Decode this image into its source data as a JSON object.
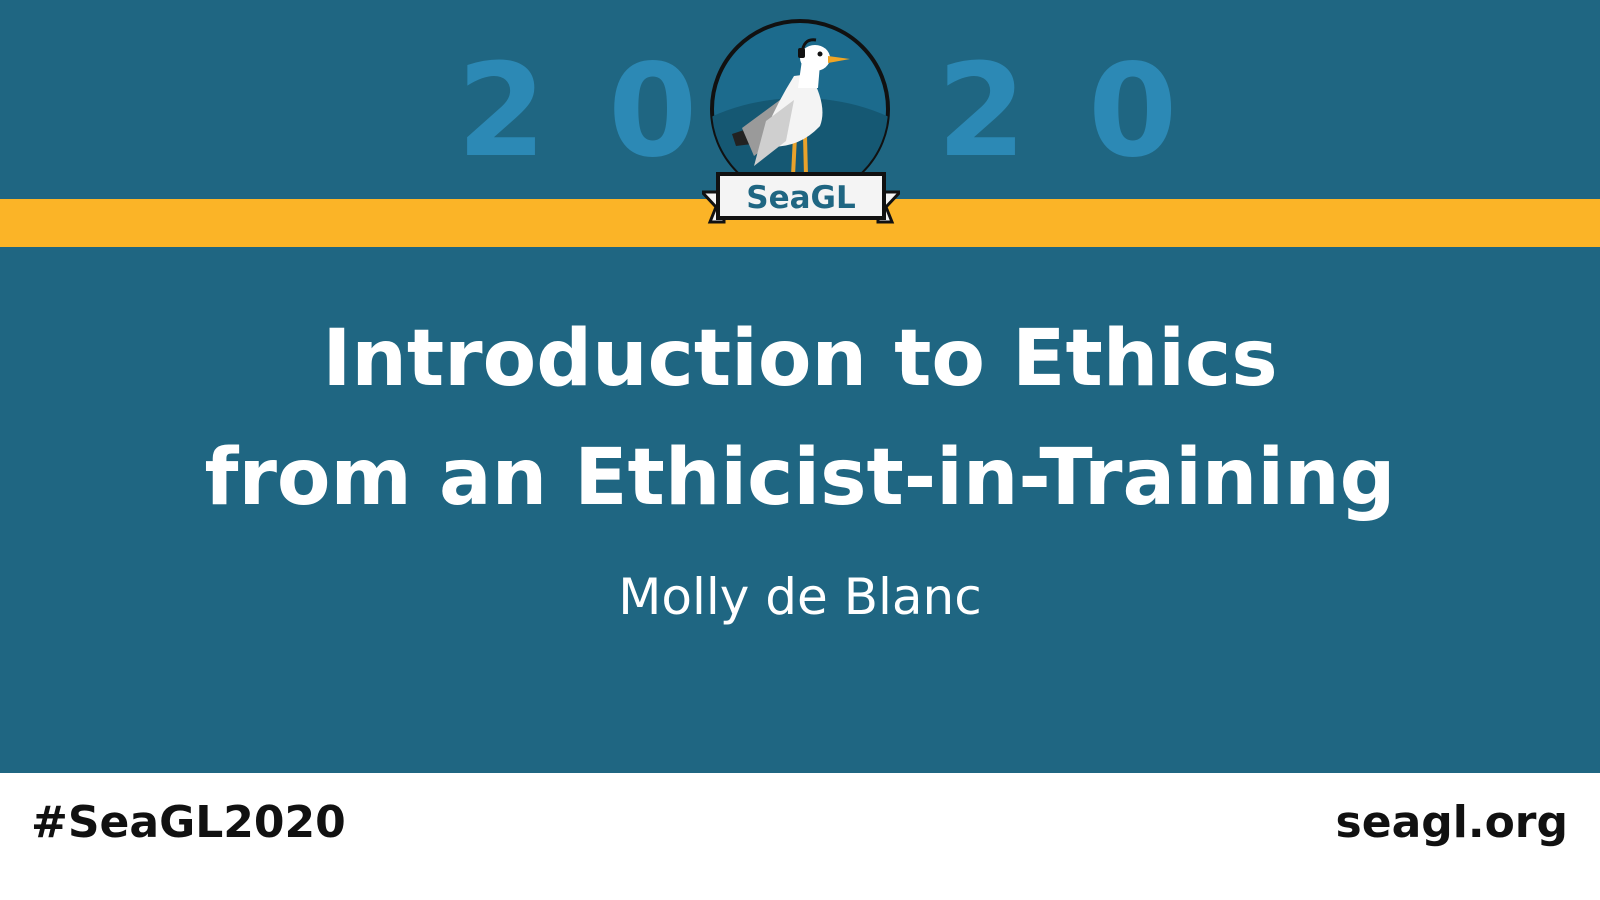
{
  "banner": {
    "year_left": "20",
    "year_right": "20",
    "logo": {
      "text": "SeaGL",
      "icon": "seagull-icon"
    }
  },
  "talk": {
    "title_line_1": "Introduction to Ethics",
    "title_line_2": "from an Ethicist-in-Training",
    "speaker": "Molly de Blanc"
  },
  "footer": {
    "hashtag": "#SeaGL2020",
    "website": "seagl.org"
  },
  "colors": {
    "background": "#1f6682",
    "year_digits": "#2c89b5",
    "gold_band": "#fbb427",
    "footer": "#ffffff",
    "text_light": "#ffffff",
    "text_dark": "#111111"
  }
}
